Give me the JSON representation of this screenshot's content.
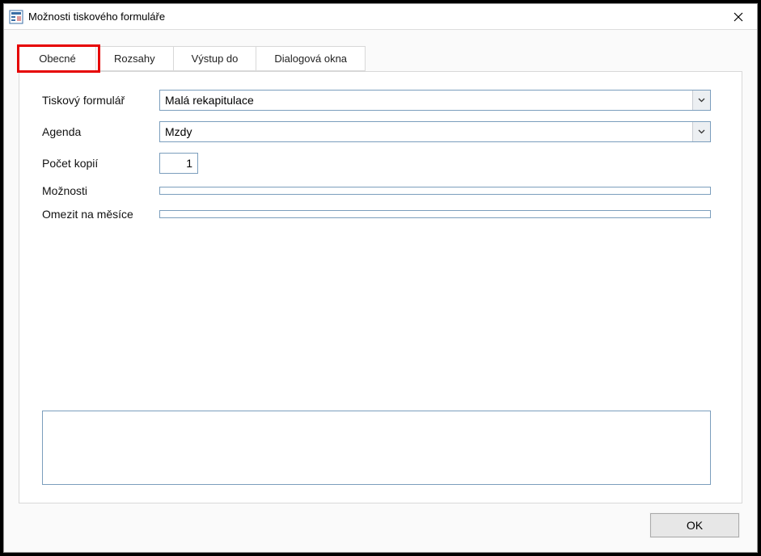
{
  "window": {
    "title": "Možnosti tiskového formuláře"
  },
  "tabs": {
    "t0": "Obecné",
    "t1": "Rozsahy",
    "t2": "Výstup do",
    "t3": "Dialogová okna"
  },
  "form": {
    "print_form_label": "Tiskový formulář",
    "print_form_value": "Malá rekapitulace",
    "agenda_label": "Agenda",
    "agenda_value": "Mzdy",
    "copies_label": "Počet kopií",
    "copies_value": "1",
    "options_label": "Možnosti",
    "options_value": "",
    "limit_months_label": "Omezit na měsíce",
    "limit_months_value": ""
  },
  "footer": {
    "ok_label": "OK"
  }
}
